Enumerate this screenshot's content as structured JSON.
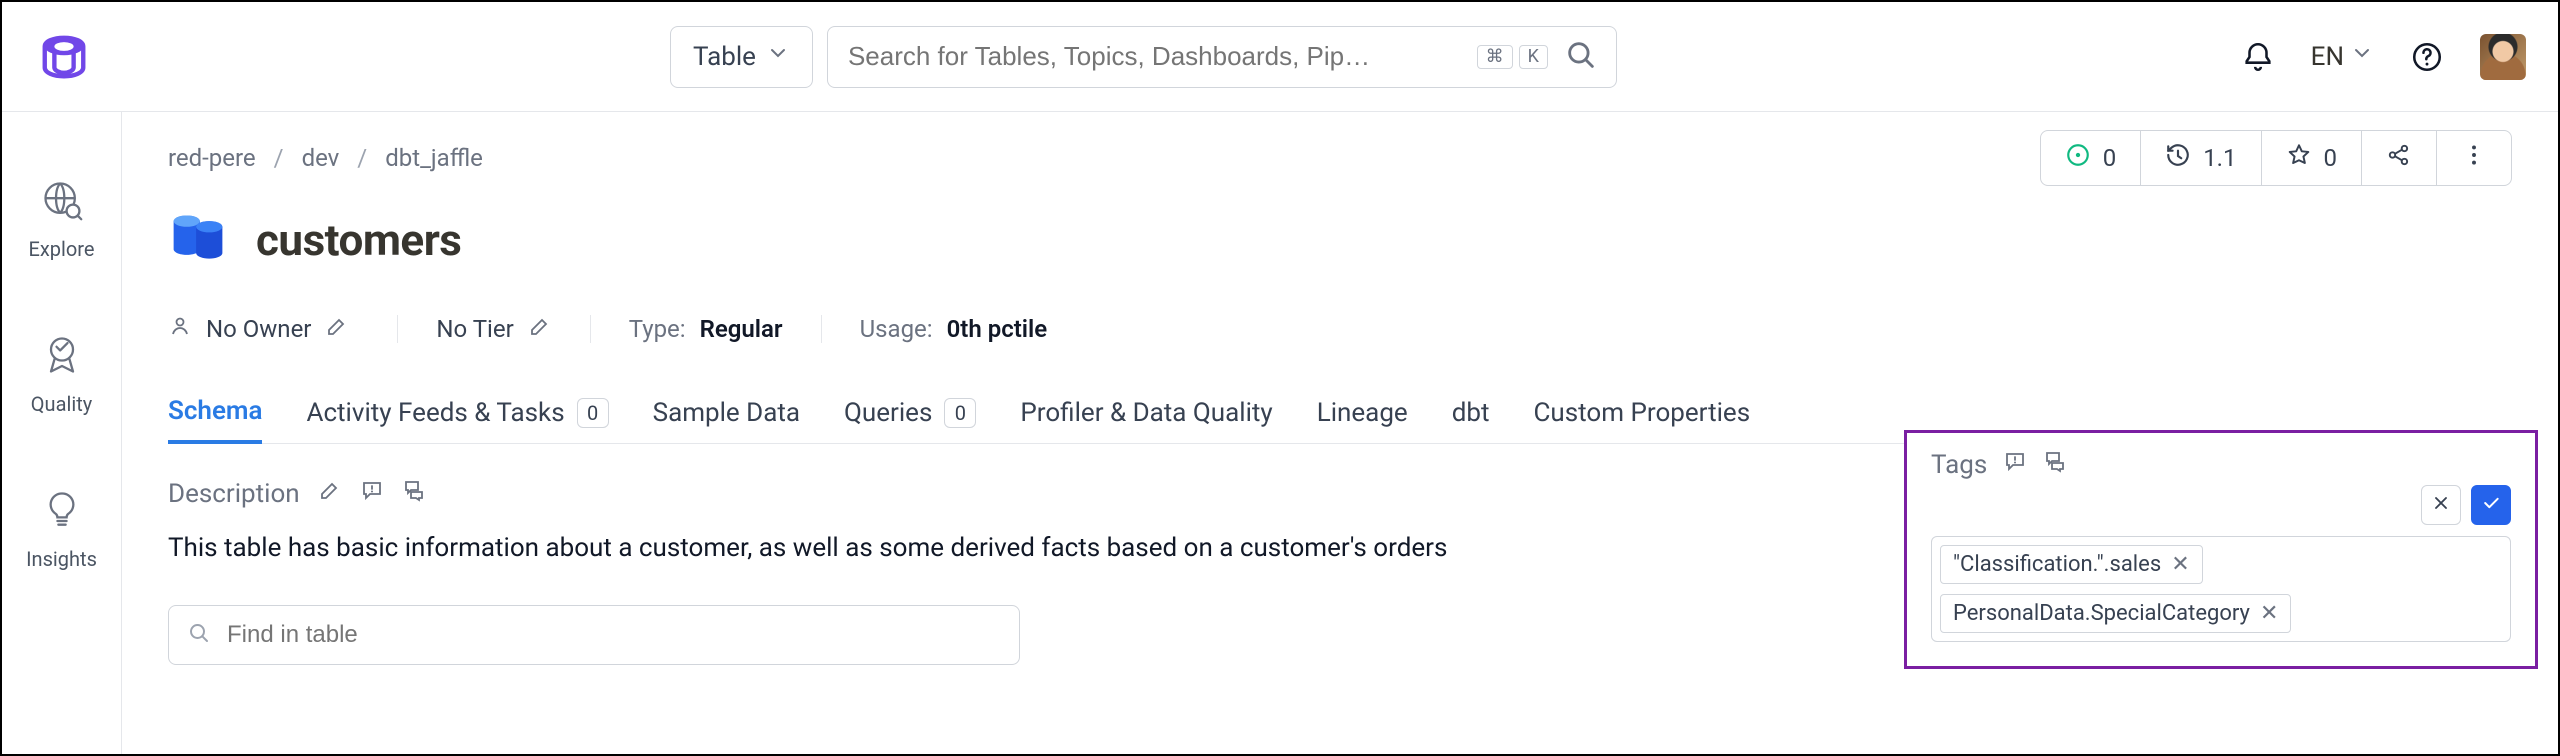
{
  "topbar": {
    "search_type_label": "Table",
    "search_placeholder": "Search for Tables, Topics, Dashboards, Pip…",
    "shortcut_keys": [
      "⌘",
      "K"
    ],
    "language_label": "EN"
  },
  "leftrail": {
    "items": [
      {
        "label": "Explore",
        "icon": "globe-search-icon"
      },
      {
        "label": "Quality",
        "icon": "ribbon-icon"
      },
      {
        "label": "Insights",
        "icon": "bulb-icon"
      }
    ]
  },
  "breadcrumb": {
    "items": [
      "red-pere",
      "dev",
      "dbt_jaffle"
    ]
  },
  "entity": {
    "title": "customers",
    "owner_label": "No Owner",
    "tier_label": "No Tier",
    "type_label": "Type:",
    "type_value": "Regular",
    "usage_label": "Usage:",
    "usage_value": "0th pctile"
  },
  "stats": {
    "running": "0",
    "version": "1.1",
    "starred": "0"
  },
  "tabs": [
    {
      "label": "Schema",
      "active": true
    },
    {
      "label": "Activity Feeds & Tasks",
      "badge": "0"
    },
    {
      "label": "Sample Data"
    },
    {
      "label": "Queries",
      "badge": "0"
    },
    {
      "label": "Profiler & Data Quality"
    },
    {
      "label": "Lineage"
    },
    {
      "label": "dbt"
    },
    {
      "label": "Custom Properties"
    }
  ],
  "description": {
    "heading": "Description",
    "text": "This table has basic information about a customer, as well as some derived facts based on a customer's orders"
  },
  "find_placeholder": "Find in table",
  "tags": {
    "heading": "Tags",
    "items": [
      "\"Classification.\".sales",
      "PersonalData.SpecialCategory"
    ]
  }
}
